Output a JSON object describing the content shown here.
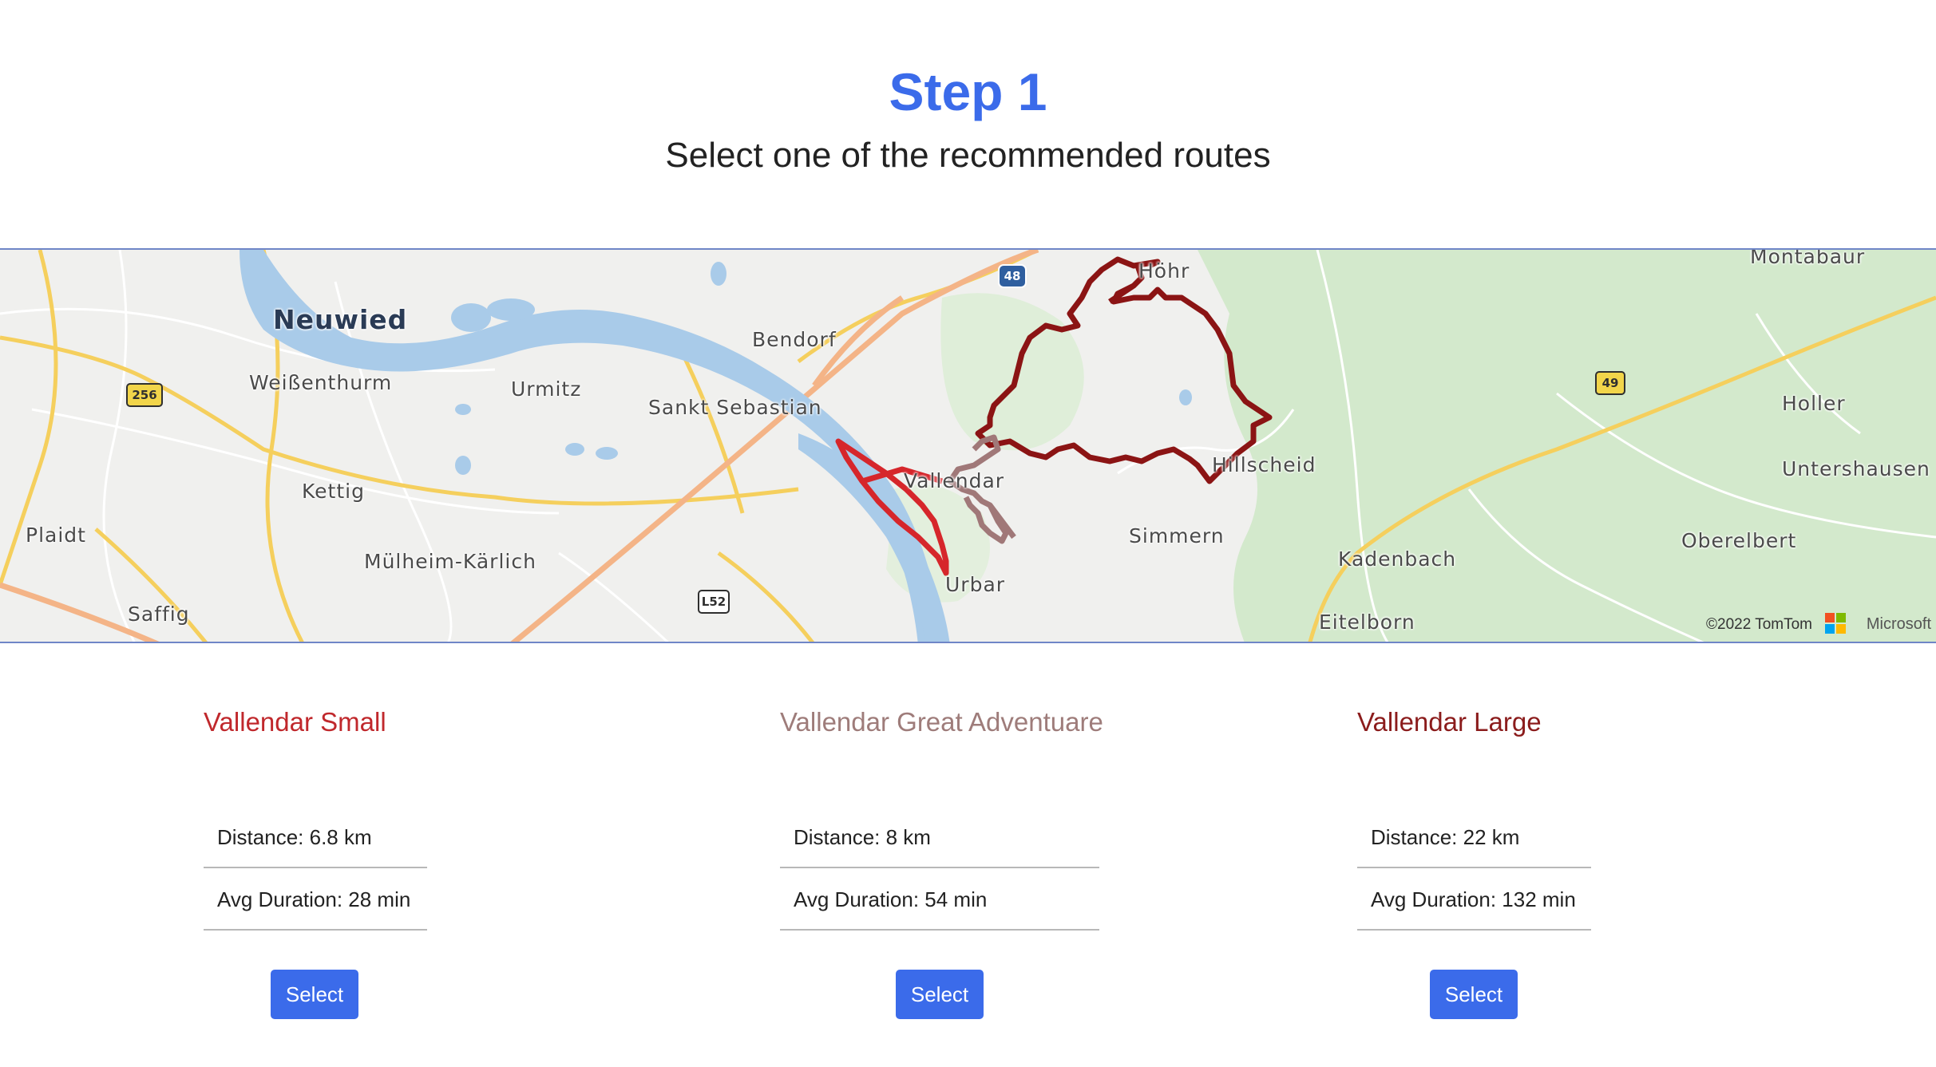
{
  "header": {
    "title": "Step 1",
    "subtitle": "Select one of the recommended routes"
  },
  "map": {
    "places": {
      "neuwied": "Neuwied",
      "weissenthurm": "Weißenthurm",
      "urmitz": "Urmitz",
      "bendorf": "Bendorf",
      "sankt_sebastian": "Sankt Sebastian",
      "kettig": "Kettig",
      "plaidt": "Plaidt",
      "muelheim_kaerlich": "Mülheim-Kärlich",
      "saffig": "Saffig",
      "vallendar": "Vallendar",
      "urbar": "Urbar",
      "hoehr": "Höhr",
      "hillscheid": "Hillscheid",
      "simmern": "Simmern",
      "kadenbach": "Kadenbach",
      "eitelborn": "Eitelborn",
      "montabaur": "Montabaur",
      "holler": "Holler",
      "untershausen": "Untershausen",
      "oberelbert": "Oberelbert"
    },
    "road_shields": {
      "b256": "256",
      "a48": "48",
      "b49": "49",
      "l52": "L52"
    },
    "copyright": "©2022 TomTom",
    "provider": "Microsoft",
    "colors": {
      "water": "#a9cbe9",
      "forest": "#cfe8c8",
      "route_small": "#d6262b",
      "route_great_adventure": "#a07878",
      "route_large": "#8b1414"
    }
  },
  "routes": [
    {
      "name": "Vallendar Small",
      "color": "#c0282c",
      "distance": "Distance: 6.8 km",
      "duration": "Avg Duration: 28 min",
      "button_label": "Select"
    },
    {
      "name": "Vallendar Great Adventuare",
      "color": "#9e7c7a",
      "distance": "Distance: 8 km",
      "duration": "Avg Duration: 54 min",
      "button_label": "Select"
    },
    {
      "name": "Vallendar Large",
      "color": "#8b1c1c",
      "distance": "Distance: 22 km",
      "duration": "Avg Duration: 132 min",
      "button_label": "Select"
    }
  ]
}
